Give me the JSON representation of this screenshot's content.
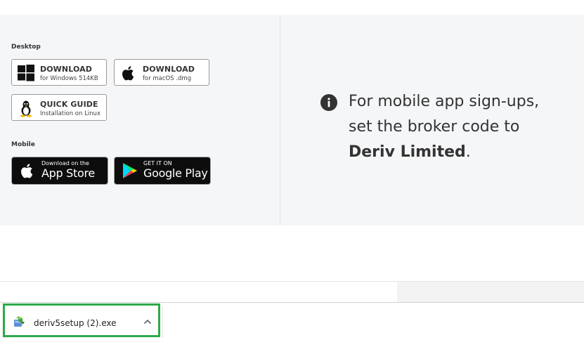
{
  "desktop": {
    "label": "Desktop",
    "windows": {
      "title": "DOWNLOAD",
      "subtitle": "for Windows 514KB"
    },
    "macos": {
      "title": "DOWNLOAD",
      "subtitle": "for macOS .dmg"
    },
    "linux": {
      "title": "QUICK GUIDE",
      "subtitle": "Installation on Linux"
    }
  },
  "mobile": {
    "label": "Mobile",
    "app_store": {
      "line1": "Download on the",
      "line2": "App Store"
    },
    "google_play": {
      "line1": "GET IT ON",
      "line2": "Google Play"
    }
  },
  "info": {
    "line1": "For mobile app sign-ups,",
    "line2": "set the broker code to",
    "broker": "Deriv Limited",
    "period": "."
  },
  "download_bar": {
    "file_name": "deriv5setup (2).exe"
  },
  "colors": {
    "panel_bg": "#f5f6f8",
    "highlight_border": "#2eaa4a",
    "store_bg": "#0d0d0d"
  }
}
